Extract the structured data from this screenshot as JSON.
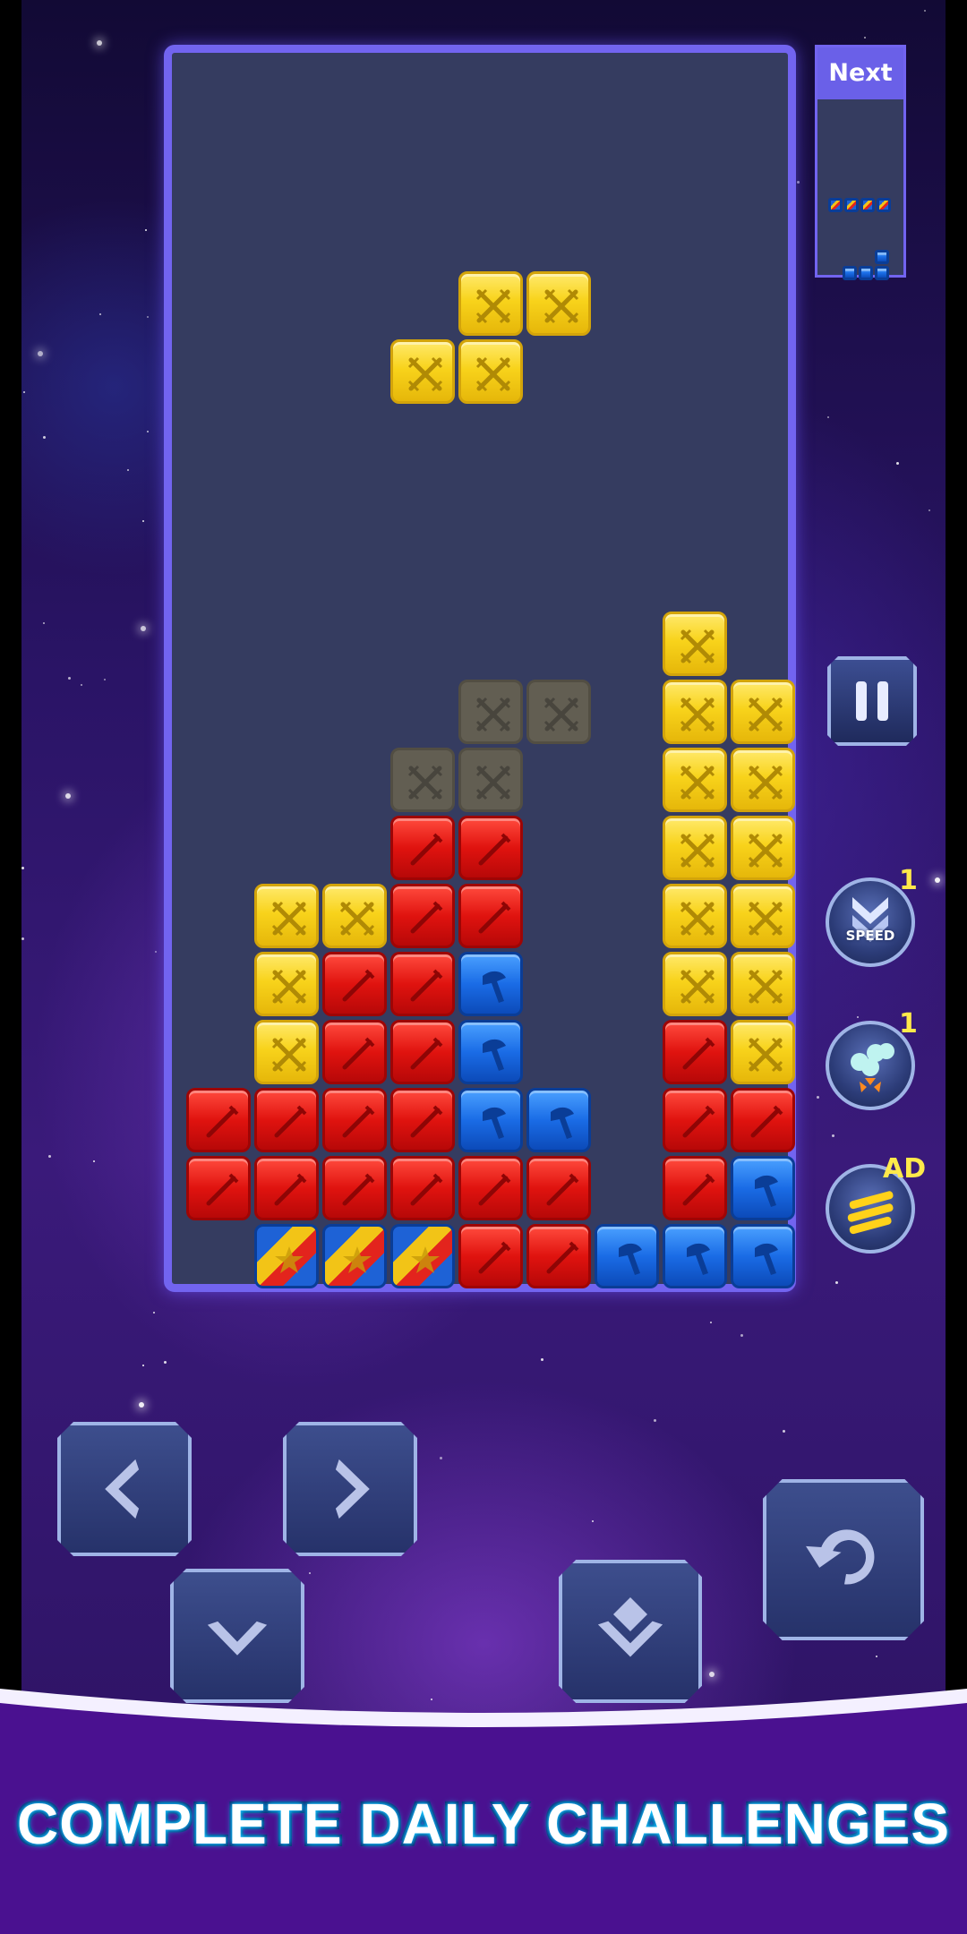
{
  "next_panel": {
    "title": "Next"
  },
  "powerups": {
    "speed": {
      "label": "SPEED",
      "count": "1"
    },
    "bomb": {
      "count": "1"
    },
    "line_clear": {
      "badge": "AD"
    }
  },
  "banner": {
    "text": "COMPLETE DAILY CHALLENGES"
  },
  "icons": {
    "pause": "pause-icon",
    "left": "arrow-left-icon",
    "right": "arrow-right-icon",
    "down": "arrow-down-icon",
    "drop": "hard-drop-icon",
    "rotate": "rotate-icon"
  },
  "colors": {
    "yellow": "#f8d31b",
    "red": "#e0130f",
    "blue": "#1a6ce6",
    "board_border": "#7264f0",
    "board_fill": "#353c60"
  },
  "board": {
    "columns": 9,
    "rows": 18,
    "falling_piece": {
      "type": "S",
      "color": "yellow",
      "cells": [
        [
          4,
          3
        ],
        [
          5,
          3
        ],
        [
          3,
          4
        ],
        [
          4,
          4
        ]
      ]
    },
    "ghost_piece": {
      "cells": [
        [
          4,
          9
        ],
        [
          5,
          9
        ],
        [
          3,
          10
        ],
        [
          4,
          10
        ]
      ]
    },
    "grid": [
      "",
      "",
      "",
      "",
      "",
      "",
      "",
      "",
      ".......Y.",
      ".......YY",
      ".......YY",
      "...RR..YY",
      ".YYRR..YY",
      ".YRRB..YY",
      ".YRRB..RY",
      "RRRRBB.RR",
      "RRRRRR.RB",
      ".SSSRRBBB"
    ]
  }
}
